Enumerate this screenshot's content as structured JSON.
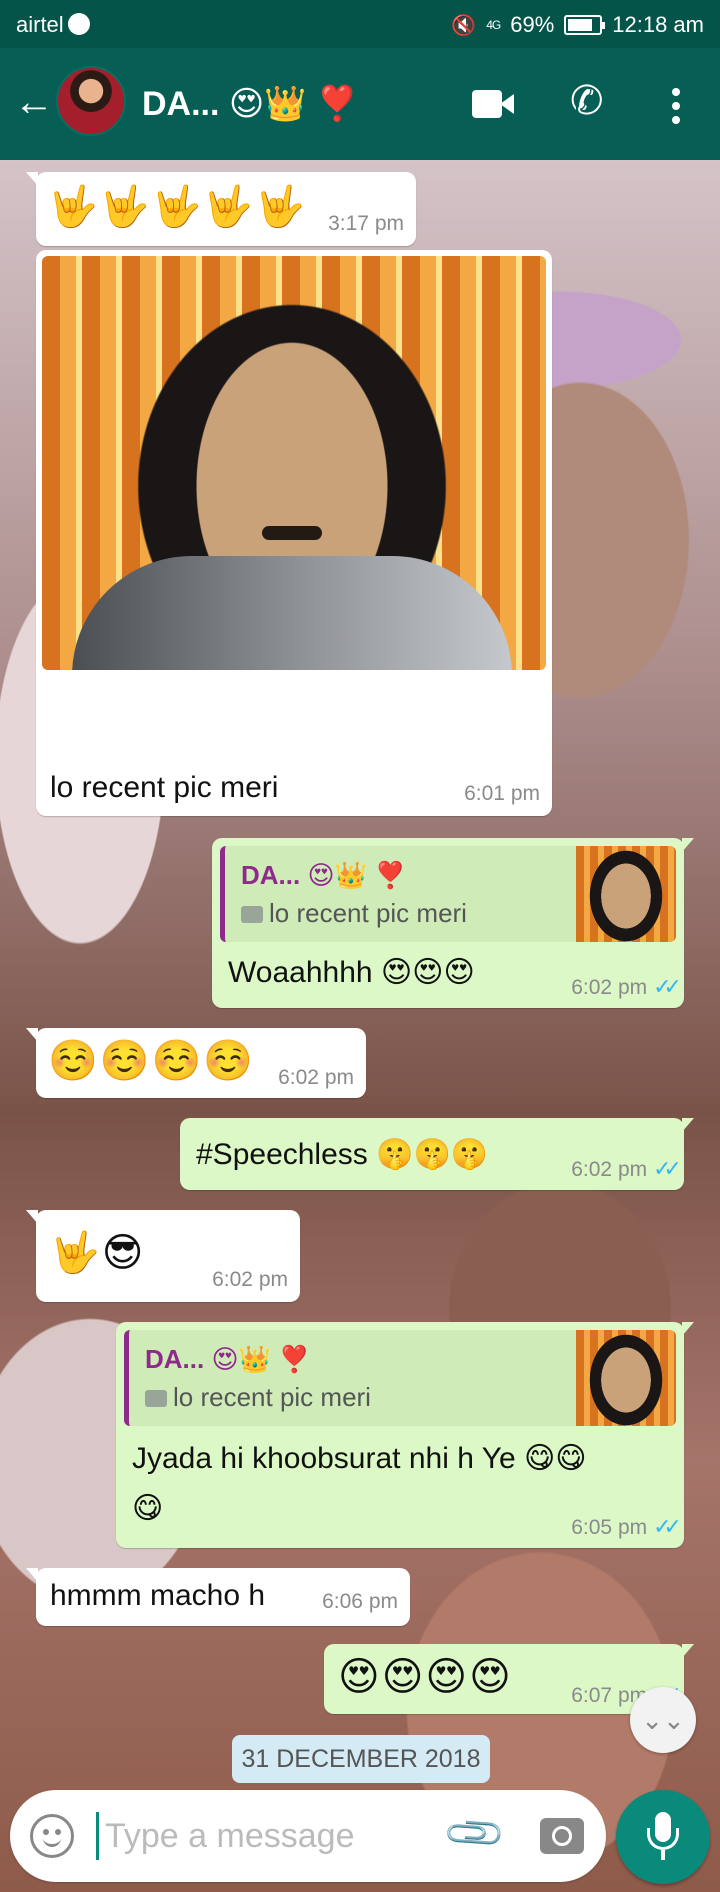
{
  "status_bar": {
    "carrier": "airtel",
    "network": "4G",
    "battery": "69%",
    "time": "12:18 am"
  },
  "header": {
    "back_icon": "arrow-left-icon",
    "contact_name": "DA... 😍👑 ❣️",
    "icons": [
      "video-call-icon",
      "phone-icon",
      "more-vert-icon"
    ]
  },
  "messages": [
    {
      "dir": "in",
      "text": "🤟🤟🤟🤟🤟",
      "time": "3:17 pm"
    },
    {
      "dir": "in",
      "type": "image",
      "caption": "lo recent pic meri",
      "time": "6:01 pm"
    },
    {
      "dir": "out",
      "reply_to": {
        "name": "DA... 😍👑 ❣️",
        "text": "lo recent pic meri"
      },
      "text": "Woaahhhh 😍😍😍",
      "time": "6:02 pm",
      "status": "read"
    },
    {
      "dir": "in",
      "text": "☺️☺️☺️☺️",
      "time": "6:02 pm"
    },
    {
      "dir": "out",
      "text": "#Speechless 🤫🤫🤫",
      "time": "6:02 pm",
      "status": "read"
    },
    {
      "dir": "in",
      "text": "🤟😎",
      "time": "6:02 pm"
    },
    {
      "dir": "out",
      "reply_to": {
        "name": "DA... 😍👑 ❣️",
        "text": "lo recent pic meri"
      },
      "text": "Jyada hi khoobsurat nhi h Ye 😋😋",
      "text2": "😋",
      "time": "6:05 pm",
      "status": "read"
    },
    {
      "dir": "in",
      "text": "hmmm macho h",
      "time": "6:06 pm"
    },
    {
      "dir": "out",
      "text": "😍😍😍😍",
      "time": "6:07 pm",
      "status": "read"
    }
  ],
  "date_chip": "31 DECEMBER 2018",
  "composer": {
    "placeholder": "Type a message"
  },
  "colors": {
    "header": "#075e54",
    "outgoing_bubble": "#dcf8c6",
    "incoming_bubble": "#ffffff",
    "read_ticks": "#34b7f1",
    "quote_accent": "#8e2a8c",
    "mic_button": "#0a8a7a"
  }
}
